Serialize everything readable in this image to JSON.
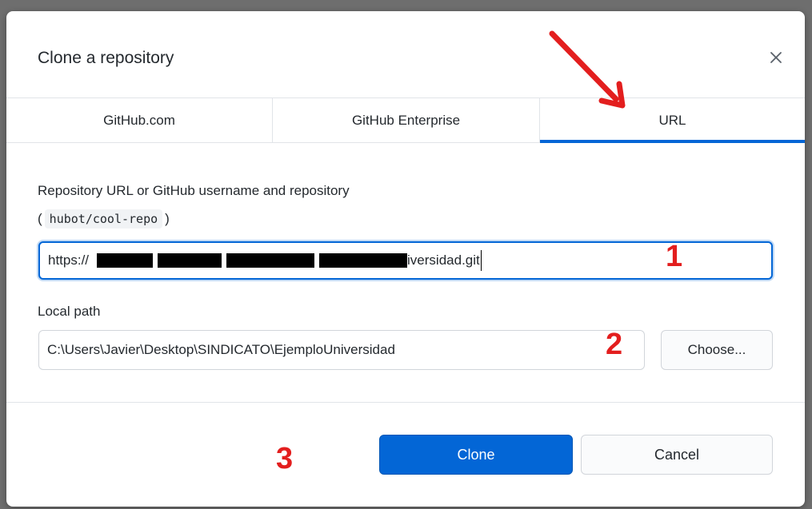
{
  "dialog": {
    "title": "Clone a repository",
    "close_icon": "close-icon"
  },
  "tabs": [
    {
      "label": "GitHub.com",
      "active": false
    },
    {
      "label": "GitHub Enterprise",
      "active": false
    },
    {
      "label": "URL",
      "active": true
    }
  ],
  "url_field": {
    "label": "Repository URL or GitHub username and repository",
    "hint_open": "(",
    "hint_code": "hubot/cool-repo",
    "hint_close": ")",
    "value_prefix": "https://",
    "value_suffix": "iversidad.git",
    "redacted": true
  },
  "path_field": {
    "label": "Local path",
    "value": "C:\\Users\\Javier\\Desktop\\SINDICATO\\EjemploUniversidad",
    "choose_label": "Choose..."
  },
  "footer": {
    "clone_label": "Clone",
    "cancel_label": "Cancel"
  },
  "annotations": {
    "step1": "1",
    "step2": "2",
    "step3": "3",
    "color": "#e31e1e"
  },
  "colors": {
    "accent": "#0366d6",
    "border": "#e1e4e8"
  }
}
